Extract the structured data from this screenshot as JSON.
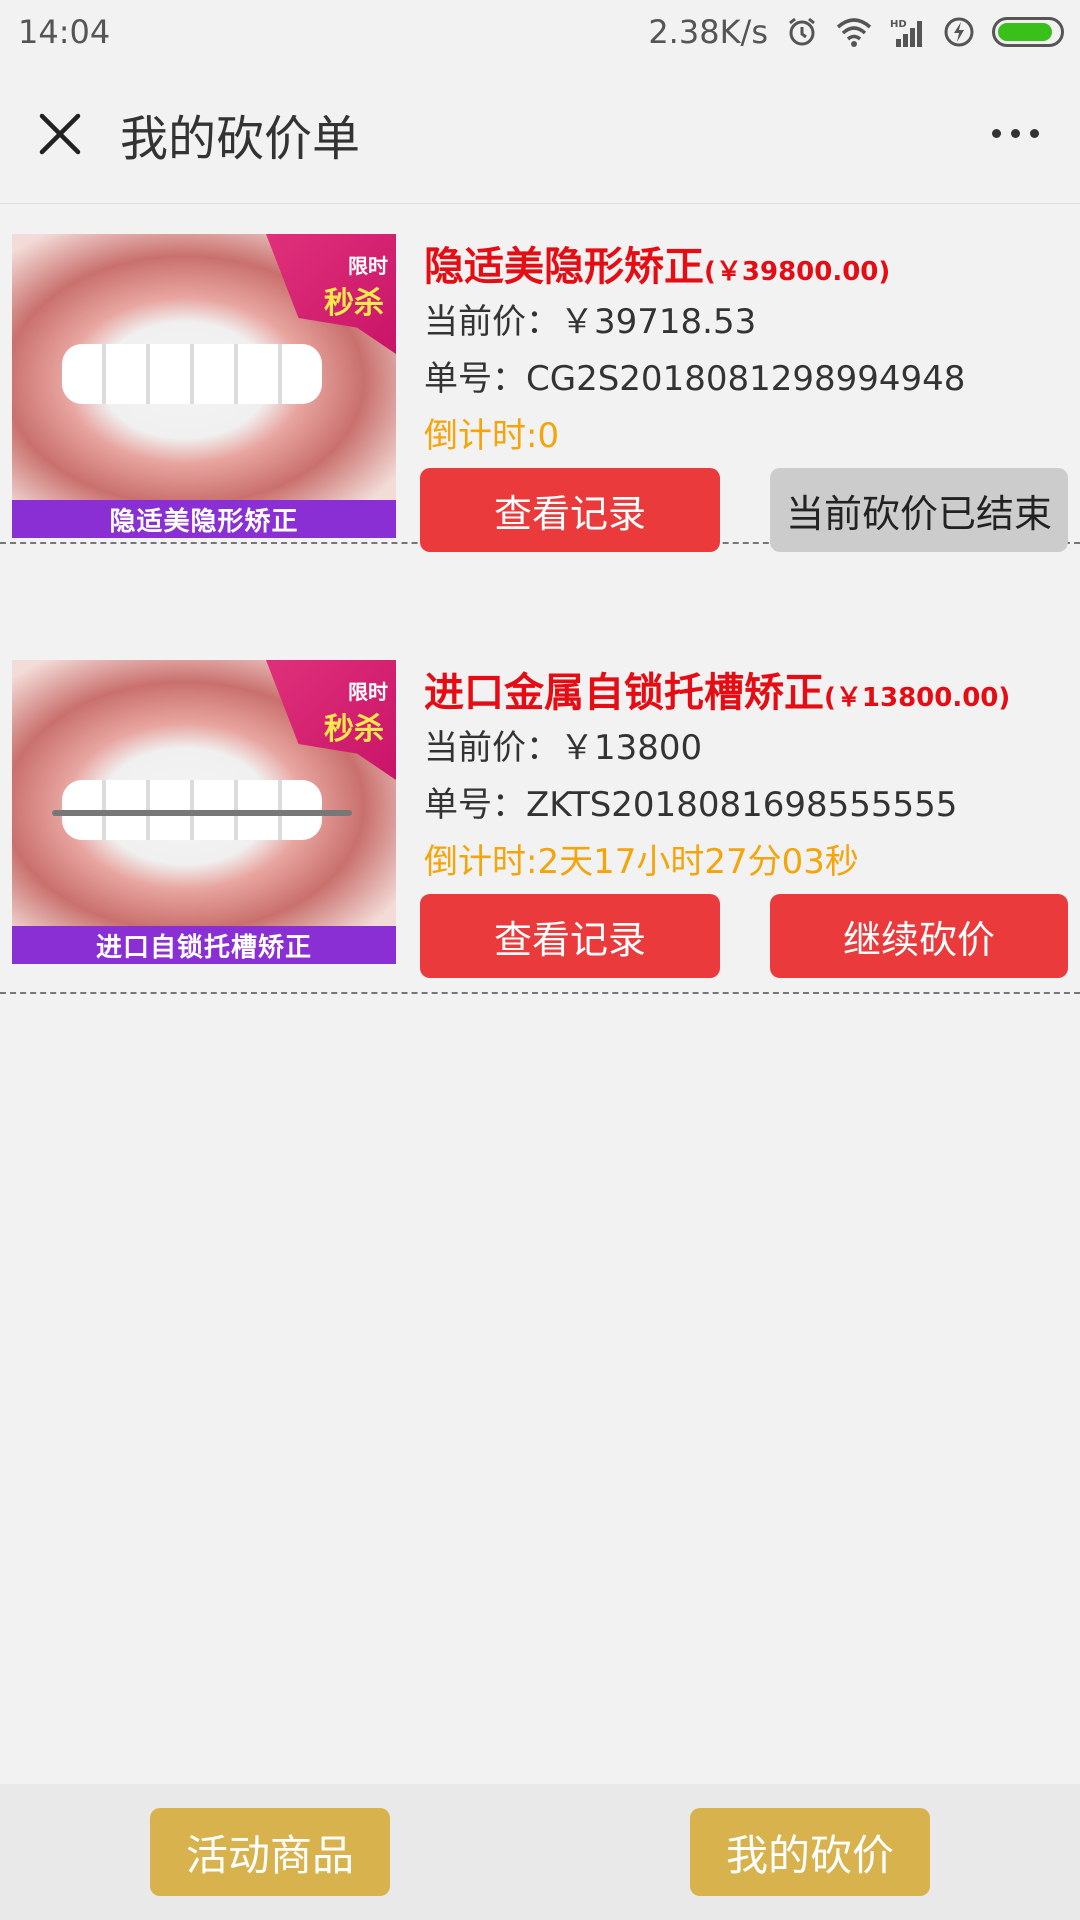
{
  "status_bar": {
    "time": "14:04",
    "network_speed": "2.38K/s",
    "icons": [
      "alarm-icon",
      "wifi-icon",
      "hd-signal-icon",
      "charging-icon",
      "battery-icon"
    ],
    "battery_level": 0.9
  },
  "nav": {
    "title": "我的砍价单",
    "close_icon": "close-icon",
    "more_icon": "more-icon"
  },
  "orders": [
    {
      "image_caption": "隐适美隐形矫正",
      "badge_small": "限时",
      "badge_big": "秒杀",
      "name": "隐适美隐形矫正",
      "original_price": "(￥39800.00)",
      "current_price": "当前价：￥39718.53",
      "order_no": "单号：CG2S2018081298994948",
      "countdown": "倒计时:0",
      "left_button": "查看记录",
      "right_button": "当前砍价已结束",
      "right_button_state": "disabled"
    },
    {
      "image_caption": "进口自锁托槽矫正",
      "badge_small": "限时",
      "badge_big": "秒杀",
      "name": "进口金属自锁托槽矫正",
      "original_price": "(￥13800.00)",
      "current_price": "当前价：￥13800",
      "order_no": "单号：ZKTS2018081698555555",
      "countdown": "倒计时:2天17小时27分03秒",
      "left_button": "查看记录",
      "right_button": "继续砍价",
      "right_button_state": "active"
    }
  ],
  "bottom": {
    "left_button": "活动商品",
    "right_button": "我的砍价"
  },
  "colors": {
    "accent_red": "#ea3a3c",
    "title_red": "#e60c14",
    "countdown_orange": "#f5a40a",
    "bottom_gold": "#d8b24c",
    "caption_purple": "#8a2fd4"
  }
}
